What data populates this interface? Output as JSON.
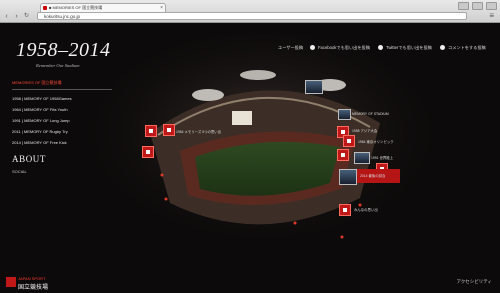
{
  "browser": {
    "tab_title": "■ MEMORIES OF 国立競技場",
    "url": "kokuritsu.jnc.go.jp"
  },
  "site": {
    "logo": "1958–2014",
    "logo_sub": "Remember Our Stadium"
  },
  "topnav": [
    {
      "label": "ユーザー投稿"
    },
    {
      "label": "Facebookでも思い出を投稿"
    },
    {
      "label": "Twitterでも思い出を投稿"
    },
    {
      "label": "コメントをする投稿"
    }
  ],
  "sidebar": {
    "heading": "MEMORIES OF 国立競技場",
    "items": [
      {
        "label": "1958 | MEMORY OF 1958Games"
      },
      {
        "label": "1964 | MEMORY OF Fifa Youth"
      },
      {
        "label": "1991 | MEMORY OF Long Jump"
      },
      {
        "label": "2011 | MEMORY OF Rugby Try"
      },
      {
        "label": "2014 | MEMORY OF Free Kick"
      }
    ],
    "about_title": "ABOUT",
    "about_sub": "SOCIAL"
  },
  "labels": {
    "left_marker": "1964 メモリーズ 5つの思い出",
    "r1": "MEMORY OF STADIUM",
    "r2": "1958 アジア大会",
    "r3": "1964 東京オリンピック",
    "r4": "1991 世界陸上",
    "r5": "2014 最後の試合",
    "r6": "みんなの思い出"
  },
  "bottom": {
    "logo_top": "JAPAN SPORT",
    "logo_bottom": "国立競技場",
    "credit": "アクセシビリティ"
  },
  "colors": {
    "accent": "#c01818",
    "sidebar_heading": "#ff4a3a",
    "page_bg": "#0c0a0a"
  }
}
